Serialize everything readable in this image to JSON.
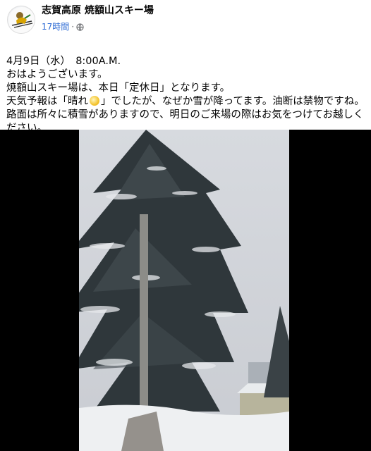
{
  "post": {
    "page_name": "志賀高原 焼額山スキー場",
    "time_ago": "17時間",
    "separator": "·",
    "privacy_icon": "globe-icon",
    "date_line": "4月9日（水）　8:00A.M.",
    "line_greeting": "おはようございます。",
    "line_closed": "焼額山スキー場は、本日「定休日」となります。",
    "line_weather_before": "天気予報は「晴れ",
    "line_weather_emoji": "sun-emoji",
    "line_weather_after": "」でしたが、なぜか雪が降ってます。油断は禁物ですね。",
    "line_road": "路面は所々に積雪がありますので、明日のご来場の際はお気をつけてお越しください。"
  },
  "media": {
    "type": "video-still",
    "subject": "snow-covered fir tree"
  }
}
